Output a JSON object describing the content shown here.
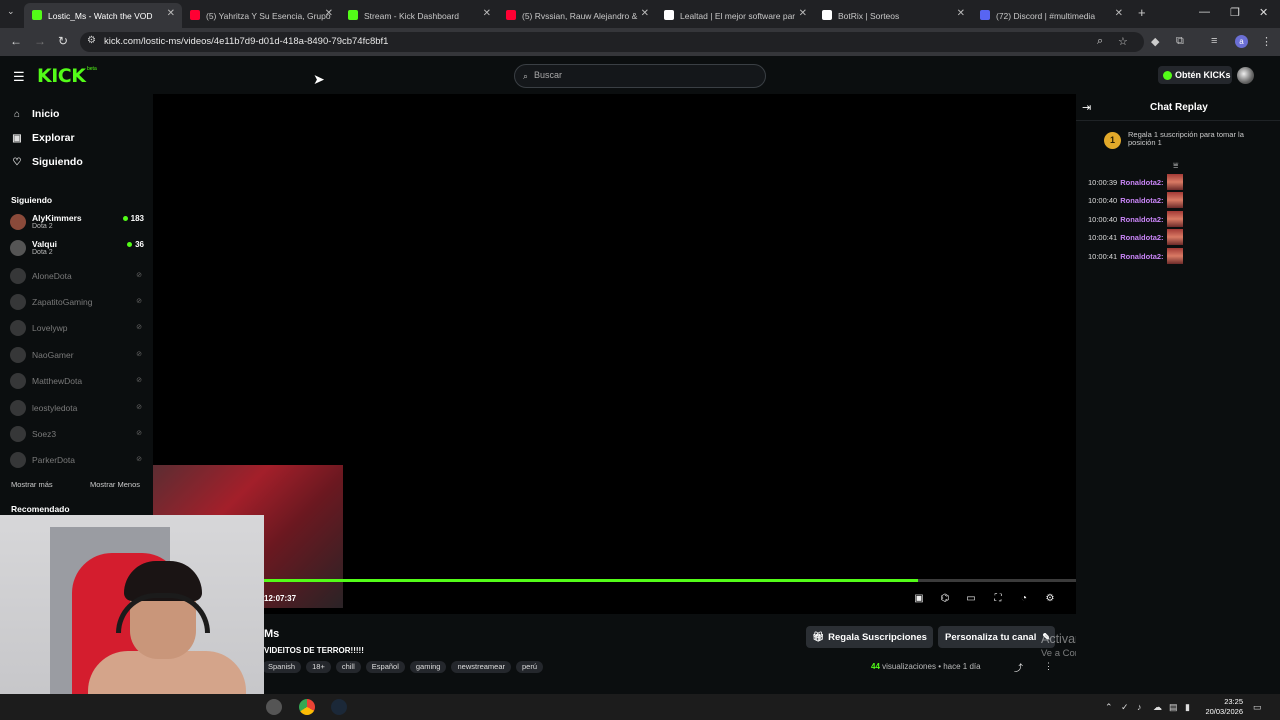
{
  "browser": {
    "tabs": [
      {
        "label": "Lostic_Ms - Watch the VOD",
        "active": true,
        "color": "#53fc18"
      },
      {
        "label": "(5) Yahritza Y Su Esencia, Grupo",
        "active": false,
        "color": "#ff0033"
      },
      {
        "label": "Stream - Kick Dashboard",
        "active": false,
        "color": "#53fc18"
      },
      {
        "label": "(5) Rvssian, Rauw Alejandro &",
        "active": false,
        "color": "#ff0033"
      },
      {
        "label": "Lealtad | El mejor software par",
        "active": false,
        "color": "#ffffff"
      },
      {
        "label": "BotRix | Sorteos",
        "active": false,
        "color": "#ffffff"
      },
      {
        "label": "(72) Discord | #multimedia",
        "active": false,
        "color": "#5865f2"
      }
    ],
    "url": "kick.com/lostic-ms/videos/4e11b7d9-d01d-418a-8490-79cb74fc8bf1",
    "profile_initial": "a"
  },
  "header": {
    "logo": "KICK",
    "logo_badge": "beta",
    "search_placeholder": "Buscar",
    "kicks_button": "Obtén KICKs"
  },
  "sidebar": {
    "nav": [
      {
        "label": "Inicio",
        "icon": "home-icon"
      },
      {
        "label": "Explorar",
        "icon": "compass-icon"
      },
      {
        "label": "Siguiendo",
        "icon": "heart-icon"
      }
    ],
    "following_title": "Siguiendo",
    "live_channels": [
      {
        "name": "AlyKimmers",
        "game": "Dota 2",
        "viewers": "183"
      },
      {
        "name": "Valqui",
        "game": "Dota 2",
        "viewers": "36"
      }
    ],
    "offline_channels": [
      "AloneDota",
      "ZapatitoGaming",
      "Lovelywp",
      "NaoGamer",
      "MatthewDota",
      "leostyledota",
      "Soez3",
      "ParkerDota"
    ],
    "show_more": "Mostrar más",
    "show_less": "Mostrar Menos",
    "recommended_title": "Recomendado"
  },
  "player": {
    "timecode": "12:07:37",
    "progress_fraction": 0.805,
    "progress_color": "#53fc18"
  },
  "video": {
    "title": "Ms",
    "subtitle": "VIDEITOS DE TERROR!!!!!",
    "tags": [
      "Spanish",
      "18+",
      "chill",
      "Español",
      "gaming",
      "newstreamear",
      "perú"
    ],
    "views_count": "44",
    "views_label": "visualizaciones",
    "separator": "•",
    "age": "hace 1 día",
    "gift_button": "Regala Suscripciones",
    "customize_button": "Personaliza tu canal"
  },
  "chat": {
    "title": "Chat Replay",
    "sub_badge": "1",
    "sub_banner": "Regala 1 suscripción para tomar la posición 1",
    "messages": [
      {
        "time": "10:00:39",
        "user": "Ronaldota2:"
      },
      {
        "time": "10:00:40",
        "user": "Ronaldota2:"
      },
      {
        "time": "10:00:40",
        "user": "Ronaldota2:"
      },
      {
        "time": "10:00:41",
        "user": "Ronaldota2:"
      },
      {
        "time": "10:00:41",
        "user": "Ronaldota2:"
      }
    ]
  },
  "windows": {
    "watermark_title": "Activar Windows",
    "watermark_sub": "Ve a Configuración para activar Windows.",
    "clock_time": "23:25",
    "clock_date": "20/03/2026"
  }
}
